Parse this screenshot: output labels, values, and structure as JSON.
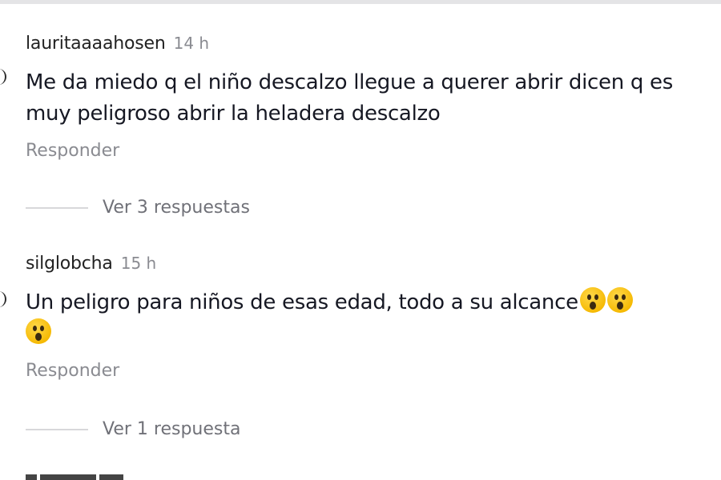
{
  "comments": [
    {
      "username": "lauritaaaahosen",
      "time": "14 h",
      "text": "Me da miedo q el niño descalzo llegue a querer abrir dicen q es muy peligroso abrir la heladera descalzo",
      "reply_label": "Responder",
      "view_replies_label": "Ver 3 respuestas"
    },
    {
      "username": "silglobcha",
      "time": "15 h",
      "text": "Un peligro para niños de esas edad, todo a su alcance",
      "emojis": [
        "astonished-face-icon",
        "astonished-face-icon",
        "astonished-face-icon"
      ],
      "reply_label": "Responder",
      "view_replies_label": "Ver 1 respuesta"
    }
  ]
}
